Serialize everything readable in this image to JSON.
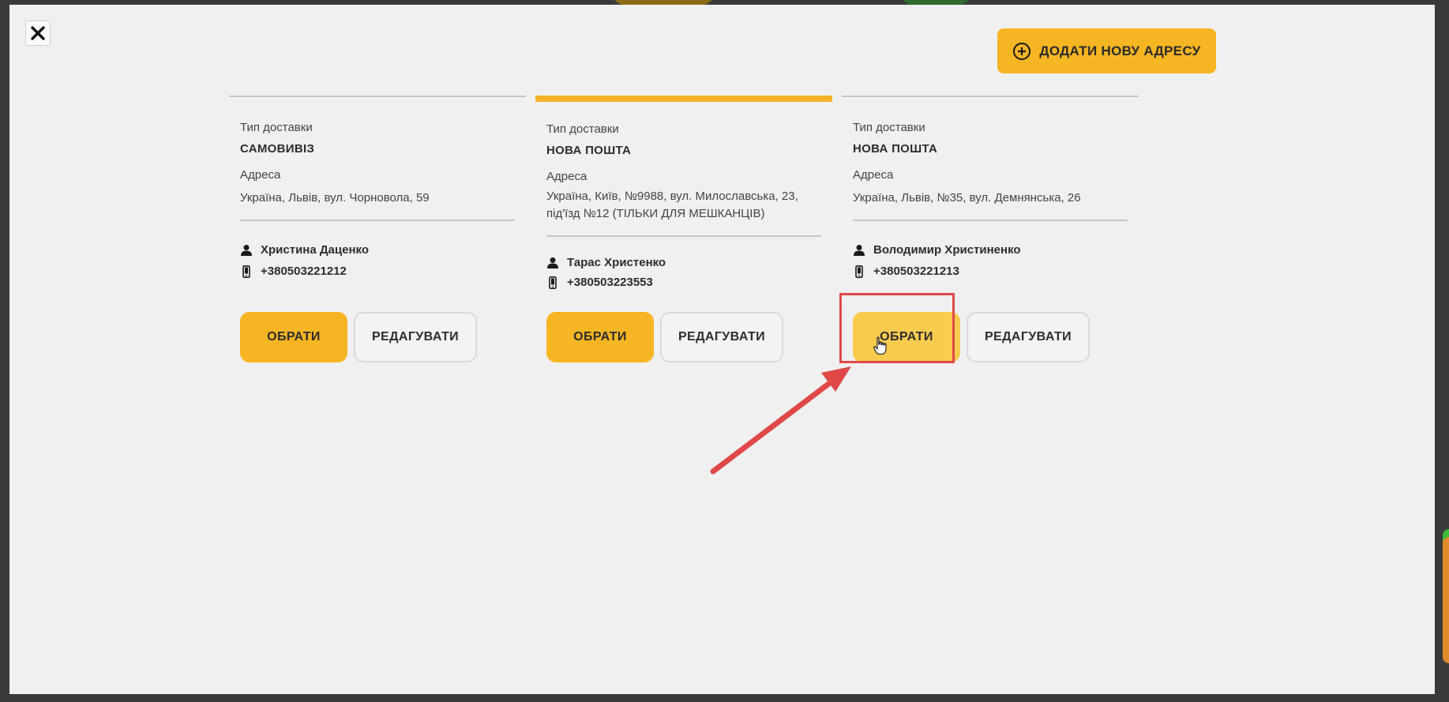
{
  "modal": {
    "add_address_label": "ДОДАТИ НОВУ АДРЕСУ"
  },
  "addresses": [
    {
      "delivery_type_label": "Тип доставки",
      "delivery_type": "САМОВИВІЗ",
      "address_label": "Адреса",
      "address": "Україна, Львів, вул. Чорновола, 59",
      "name": "Христина Даценко",
      "phone": "+380503221212",
      "select_label": "ОБРАТИ",
      "edit_label": "РЕДАГУВАТИ",
      "active": false
    },
    {
      "delivery_type_label": "Тип доставки",
      "delivery_type": "НОВА ПОШТА",
      "address_label": "Адреса",
      "address": "Україна, Київ, №9988, вул. Милославська, 23, під'їзд №12 (ТІЛЬКИ ДЛЯ МЕШКАНЦІВ)",
      "name": "Тарас Христенко",
      "phone": "+380503223553",
      "select_label": "ОБРАТИ",
      "edit_label": "РЕДАГУВАТИ",
      "active": true
    },
    {
      "delivery_type_label": "Тип доставки",
      "delivery_type": "НОВА ПОШТА",
      "address_label": "Адреса",
      "address": "Україна, Львів, №35, вул. Демнянська, 26",
      "name": "Володимир Христиненко",
      "phone": "+380503221213",
      "select_label": "ОБРАТИ",
      "edit_label": "РЕДАГУВАТИ",
      "active": false
    }
  ],
  "colors": {
    "accent": "#f6b522",
    "accent_hover": "#f9cb4f",
    "annotation_red": "#e04848"
  },
  "icons": {
    "close": "close-icon",
    "add": "plus-circle-icon",
    "person": "person-icon",
    "phone": "phone-icon",
    "cursor": "hand-pointer-icon"
  }
}
